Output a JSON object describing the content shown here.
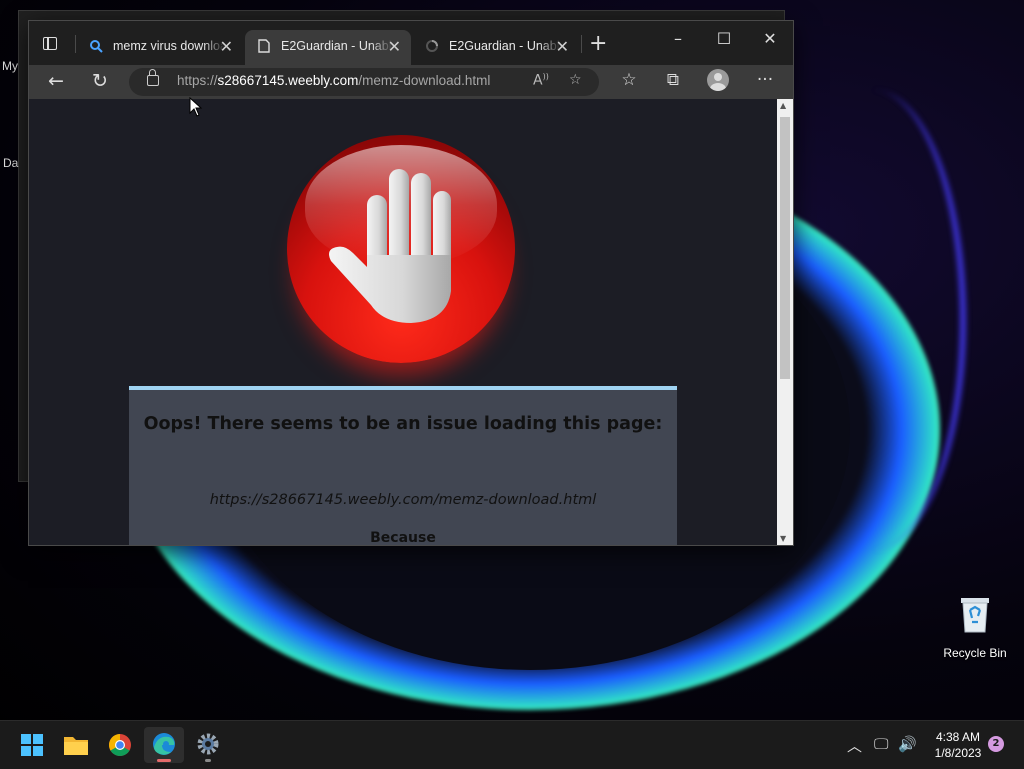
{
  "desktop": {
    "left_labels": [
      "My",
      "Da"
    ],
    "recycle_bin_label": "Recycle Bin"
  },
  "browser": {
    "tabs": [
      {
        "label": "memz virus download",
        "icon": "search-icon",
        "active": false
      },
      {
        "label": "E2Guardian - Unable",
        "icon": "page-icon",
        "active": true
      },
      {
        "label": "E2Guardian - Unable",
        "icon": "loading-icon",
        "active": false
      }
    ],
    "address": {
      "prefix": "https://",
      "domain": "s28667145.weebly.com",
      "path": "/memz-download.html"
    }
  },
  "page": {
    "error_title": "Oops! There seems to be an issue loading this page:",
    "error_url": "https://s28667145.weebly.com/memz-download.html",
    "because": "Because"
  },
  "taskbar": {
    "clock_time": "4:38 AM",
    "clock_date": "1/8/2023",
    "notification_count": "2"
  }
}
